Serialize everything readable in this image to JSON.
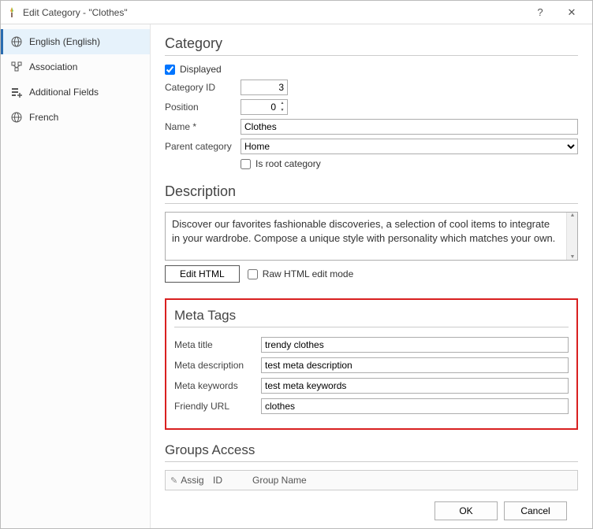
{
  "window": {
    "title": "Edit Category - \"Clothes\"",
    "help_glyph": "?",
    "close_glyph": "✕"
  },
  "sidebar": {
    "items": [
      {
        "label": "English (English)",
        "active": true
      },
      {
        "label": "Association",
        "active": false
      },
      {
        "label": "Additional Fields",
        "active": false
      },
      {
        "label": "French",
        "active": false
      }
    ]
  },
  "category": {
    "heading": "Category",
    "displayed_label": "Displayed",
    "displayed": true,
    "id_label": "Category ID",
    "id_value": "3",
    "position_label": "Position",
    "position_value": "0",
    "name_label": "Name *",
    "name_value": "Clothes",
    "parent_label": "Parent category",
    "parent_value": "Home",
    "is_root_label": "Is root category",
    "is_root": false
  },
  "description": {
    "heading": "Description",
    "text": "Discover our favorites fashionable discoveries, a selection of cool items to integrate in your wardrobe. Compose a unique style with personality which matches your own.",
    "edit_html_label": "Edit HTML",
    "raw_mode_label": "Raw HTML edit mode",
    "raw_mode": false
  },
  "meta": {
    "heading": "Meta Tags",
    "title_label": "Meta title",
    "title_value": "trendy clothes",
    "desc_label": "Meta description",
    "desc_value": "test meta description",
    "keywords_label": "Meta keywords",
    "keywords_value": "test meta keywords",
    "url_label": "Friendly URL",
    "url_value": "clothes"
  },
  "groups": {
    "heading": "Groups Access",
    "col_assig": "Assig",
    "col_id": "ID",
    "col_name": "Group Name"
  },
  "buttons": {
    "ok": "OK",
    "cancel": "Cancel"
  }
}
